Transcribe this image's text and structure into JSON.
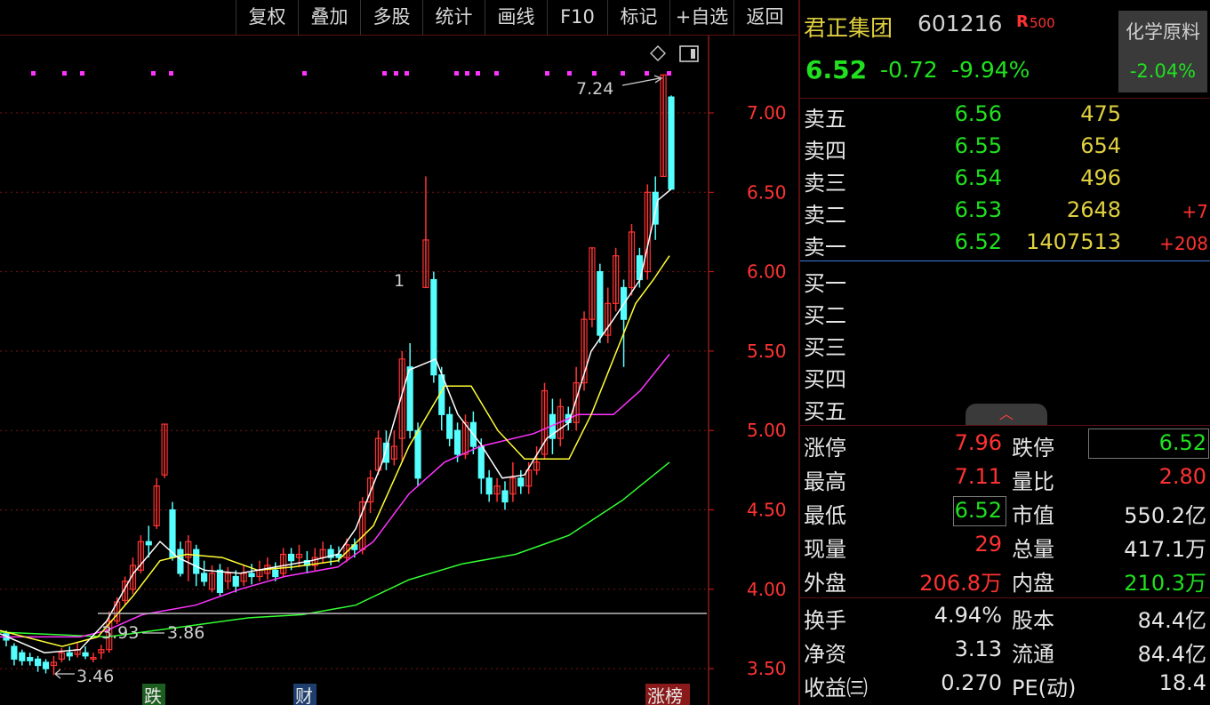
{
  "toolbar": {
    "buttons": [
      "复权",
      "叠加",
      "多股",
      "统计",
      "画线",
      "F10",
      "标记",
      "+自选",
      "返回"
    ]
  },
  "chart": {
    "price_labels": [
      "7.00",
      "6.50",
      "6.00",
      "5.50",
      "5.00",
      "4.50",
      "4.00",
      "3.50"
    ],
    "annotations": {
      "high": "7.24",
      "low": "3.46",
      "left_a": "3.93",
      "left_b": "3.86",
      "marker": "1"
    },
    "event_tags": [
      "跌",
      "财",
      "涨榜"
    ],
    "colors": {
      "up": "#ff3333",
      "down": "#55ffff",
      "ma5": "#ffffff",
      "ma10": "#ffff33",
      "ma20": "#ff33ff",
      "ma60": "#33ff33",
      "grid": "#7a1414"
    }
  },
  "chart_data": {
    "type": "candlestick",
    "ylim": [
      3.4,
      7.35
    ],
    "candles": [
      [
        3.72,
        3.68,
        3.74,
        3.64
      ],
      [
        3.64,
        3.56,
        3.66,
        3.52
      ],
      [
        3.6,
        3.55,
        3.62,
        3.52
      ],
      [
        3.57,
        3.55,
        3.6,
        3.52
      ],
      [
        3.56,
        3.52,
        3.58,
        3.48
      ],
      [
        3.54,
        3.5,
        3.56,
        3.47
      ],
      [
        3.52,
        3.54,
        3.58,
        3.46
      ],
      [
        3.56,
        3.6,
        3.63,
        3.54
      ],
      [
        3.6,
        3.58,
        3.64,
        3.55
      ],
      [
        3.59,
        3.62,
        3.66,
        3.57
      ],
      [
        3.6,
        3.58,
        3.64,
        3.56
      ],
      [
        3.56,
        3.57,
        3.6,
        3.54
      ],
      [
        3.6,
        3.62,
        3.65,
        3.56
      ],
      [
        3.62,
        3.8,
        3.86,
        3.6
      ],
      [
        3.8,
        3.92,
        3.95,
        3.78
      ],
      [
        3.93,
        4.05,
        4.08,
        3.9
      ],
      [
        4.0,
        4.15,
        4.2,
        3.97
      ],
      [
        4.12,
        4.3,
        4.34,
        4.1
      ],
      [
        4.3,
        4.28,
        4.4,
        4.2
      ],
      [
        4.4,
        4.65,
        4.7,
        4.38
      ],
      [
        4.72,
        5.04,
        5.04,
        4.7
      ],
      [
        4.5,
        4.2,
        4.55,
        4.18
      ],
      [
        4.25,
        4.1,
        4.3,
        4.08
      ],
      [
        4.2,
        4.3,
        4.34,
        4.05
      ],
      [
        4.25,
        4.1,
        4.28,
        4.02
      ],
      [
        4.1,
        4.05,
        4.18,
        4.02
      ],
      [
        4.0,
        4.1,
        4.15,
        3.98
      ],
      [
        4.12,
        3.98,
        4.16,
        3.96
      ],
      [
        4.05,
        4.1,
        4.14,
        4.0
      ],
      [
        4.08,
        4.02,
        4.12,
        3.98
      ],
      [
        4.05,
        4.1,
        4.15,
        4.02
      ],
      [
        4.1,
        4.08,
        4.16,
        4.03
      ],
      [
        4.08,
        4.12,
        4.18,
        4.05
      ],
      [
        4.1,
        4.15,
        4.2,
        4.06
      ],
      [
        4.12,
        4.08,
        4.17,
        4.05
      ],
      [
        4.1,
        4.22,
        4.26,
        4.08
      ],
      [
        4.22,
        4.18,
        4.26,
        4.12
      ],
      [
        4.2,
        4.22,
        4.28,
        4.14
      ],
      [
        4.18,
        4.15,
        4.24,
        4.1
      ],
      [
        4.15,
        4.2,
        4.26,
        4.12
      ],
      [
        4.2,
        4.25,
        4.3,
        4.16
      ],
      [
        4.25,
        4.2,
        4.28,
        4.15
      ],
      [
        4.22,
        4.2,
        4.27,
        4.17
      ],
      [
        4.2,
        4.28,
        4.32,
        4.17
      ],
      [
        4.28,
        4.25,
        4.32,
        4.2
      ],
      [
        4.25,
        4.55,
        4.58,
        4.22
      ],
      [
        4.55,
        4.7,
        4.75,
        4.48
      ],
      [
        4.75,
        4.95,
        5.0,
        4.72
      ],
      [
        4.92,
        4.8,
        5.0,
        4.75
      ],
      [
        4.82,
        4.9,
        5.0,
        4.78
      ],
      [
        4.95,
        5.45,
        5.5,
        4.8
      ],
      [
        5.4,
        5.0,
        5.55,
        4.95
      ],
      [
        5.0,
        4.7,
        5.05,
        4.65
      ],
      [
        5.9,
        6.2,
        6.6,
        5.9
      ],
      [
        5.95,
        5.35,
        6.0,
        5.3
      ],
      [
        5.35,
        5.1,
        5.4,
        5.0
      ],
      [
        5.1,
        4.95,
        5.15,
        4.9
      ],
      [
        5.0,
        4.85,
        5.05,
        4.8
      ],
      [
        4.85,
        5.05,
        5.1,
        4.82
      ],
      [
        5.05,
        4.9,
        5.12,
        4.85
      ],
      [
        4.9,
        4.7,
        4.95,
        4.6
      ],
      [
        4.7,
        4.6,
        4.75,
        4.55
      ],
      [
        4.6,
        4.65,
        4.7,
        4.55
      ],
      [
        4.62,
        4.55,
        4.68,
        4.5
      ],
      [
        4.6,
        4.7,
        4.8,
        4.55
      ],
      [
        4.7,
        4.65,
        4.75,
        4.6
      ],
      [
        4.65,
        4.75,
        4.8,
        4.6
      ],
      [
        4.75,
        4.8,
        4.9,
        4.72
      ],
      [
        4.85,
        5.25,
        5.3,
        4.82
      ],
      [
        5.1,
        4.95,
        5.2,
        4.85
      ],
      [
        4.95,
        5.15,
        5.2,
        4.9
      ],
      [
        5.1,
        5.05,
        5.15,
        5.0
      ],
      [
        5.05,
        5.3,
        5.4,
        5.0
      ],
      [
        5.3,
        5.7,
        5.75,
        5.25
      ],
      [
        5.7,
        6.15,
        6.15,
        5.65
      ],
      [
        6.0,
        5.6,
        6.05,
        5.55
      ],
      [
        5.6,
        5.8,
        5.9,
        5.55
      ],
      [
        5.8,
        6.1,
        6.15,
        5.75
      ],
      [
        5.9,
        5.7,
        5.95,
        5.4
      ],
      [
        5.9,
        6.25,
        6.3,
        5.85
      ],
      [
        6.1,
        5.95,
        6.15,
        5.9
      ],
      [
        6.0,
        6.5,
        6.55,
        5.95
      ],
      [
        6.5,
        6.3,
        6.6,
        6.2
      ],
      [
        6.6,
        7.24,
        7.24,
        6.6
      ],
      [
        7.1,
        6.52,
        7.11,
        6.52
      ]
    ],
    "ma5": [
      [
        0,
        3.72
      ],
      [
        50,
        3.6
      ],
      [
        90,
        3.62
      ],
      [
        120,
        3.8
      ],
      [
        150,
        4.1
      ],
      [
        180,
        4.3
      ],
      [
        200,
        4.2
      ],
      [
        230,
        4.12
      ],
      [
        270,
        4.1
      ],
      [
        310,
        4.14
      ],
      [
        350,
        4.18
      ],
      [
        380,
        4.22
      ],
      [
        400,
        4.38
      ],
      [
        430,
        4.8
      ],
      [
        460,
        5.38
      ],
      [
        490,
        5.45
      ],
      [
        515,
        5.1
      ],
      [
        540,
        4.92
      ],
      [
        565,
        4.7
      ],
      [
        590,
        4.72
      ],
      [
        615,
        4.95
      ],
      [
        640,
        5.05
      ],
      [
        665,
        5.5
      ],
      [
        690,
        5.7
      ],
      [
        720,
        5.95
      ],
      [
        740,
        6.45
      ],
      [
        755,
        6.52
      ]
    ],
    "ma10": [
      [
        0,
        3.74
      ],
      [
        70,
        3.64
      ],
      [
        110,
        3.7
      ],
      [
        150,
        3.96
      ],
      [
        180,
        4.18
      ],
      [
        210,
        4.22
      ],
      [
        250,
        4.2
      ],
      [
        290,
        4.12
      ],
      [
        330,
        4.14
      ],
      [
        380,
        4.18
      ],
      [
        420,
        4.4
      ],
      [
        460,
        4.9
      ],
      [
        500,
        5.28
      ],
      [
        530,
        5.28
      ],
      [
        560,
        5.0
      ],
      [
        590,
        4.82
      ],
      [
        640,
        4.82
      ],
      [
        665,
        5.1
      ],
      [
        690,
        5.45
      ],
      [
        715,
        5.8
      ],
      [
        735,
        5.95
      ],
      [
        753,
        6.1
      ]
    ],
    "ma20": [
      [
        0,
        3.7
      ],
      [
        90,
        3.7
      ],
      [
        120,
        3.74
      ],
      [
        160,
        3.84
      ],
      [
        220,
        3.9
      ],
      [
        270,
        4.0
      ],
      [
        320,
        4.08
      ],
      [
        380,
        4.14
      ],
      [
        420,
        4.3
      ],
      [
        460,
        4.6
      ],
      [
        500,
        4.8
      ],
      [
        540,
        4.9
      ],
      [
        600,
        4.98
      ],
      [
        650,
        5.1
      ],
      [
        690,
        5.1
      ],
      [
        720,
        5.25
      ],
      [
        753,
        5.48
      ]
    ],
    "ma60": [
      [
        0,
        3.73
      ],
      [
        120,
        3.7
      ],
      [
        200,
        3.76
      ],
      [
        280,
        3.82
      ],
      [
        340,
        3.84
      ],
      [
        400,
        3.9
      ],
      [
        460,
        4.06
      ],
      [
        520,
        4.16
      ],
      [
        580,
        4.22
      ],
      [
        640,
        4.34
      ],
      [
        700,
        4.56
      ],
      [
        753,
        4.8
      ]
    ]
  },
  "panel": {
    "name": "君正集团",
    "code": "601216",
    "r_tag": "R",
    "r_num": "500",
    "sector": "化学原料",
    "sector_change": "-2.04%",
    "price": "6.52",
    "change": "-0.72",
    "change_pct": "-9.94%",
    "asks": [
      {
        "label": "卖五",
        "price": "6.56",
        "vol": "475",
        "delta": ""
      },
      {
        "label": "卖四",
        "price": "6.55",
        "vol": "654",
        "delta": ""
      },
      {
        "label": "卖三",
        "price": "6.54",
        "vol": "496",
        "delta": ""
      },
      {
        "label": "卖二",
        "price": "6.53",
        "vol": "2648",
        "delta": "+7"
      },
      {
        "label": "卖一",
        "price": "6.52",
        "vol": "1407513",
        "delta": "+208"
      }
    ],
    "bids": [
      "买一",
      "买二",
      "买三",
      "买四",
      "买五"
    ],
    "stats": {
      "zt_label": "涨停",
      "zt": "7.96",
      "dt_label": "跌停",
      "dt": "6.52",
      "high_label": "最高",
      "high": "7.11",
      "lb_label": "量比",
      "lb": "2.80",
      "low_label": "最低",
      "low": "6.52",
      "mv_label": "市值",
      "mv": "550.2亿",
      "cur_label": "现量",
      "cur": "29",
      "tot_label": "总量",
      "tot": "417.1万",
      "out_label": "外盘",
      "out": "206.8万",
      "in_label": "内盘",
      "in": "210.3万",
      "hs_label": "换手",
      "hs": "4.94%",
      "gb_label": "股本",
      "gb": "84.4亿",
      "jz_label": "净资",
      "jz": "3.13",
      "lt_label": "流通",
      "lt": "84.4亿",
      "sy_label": "收益㈢",
      "sy": "0.270",
      "pe_label": "PE(动)",
      "pe": "18.4"
    }
  }
}
